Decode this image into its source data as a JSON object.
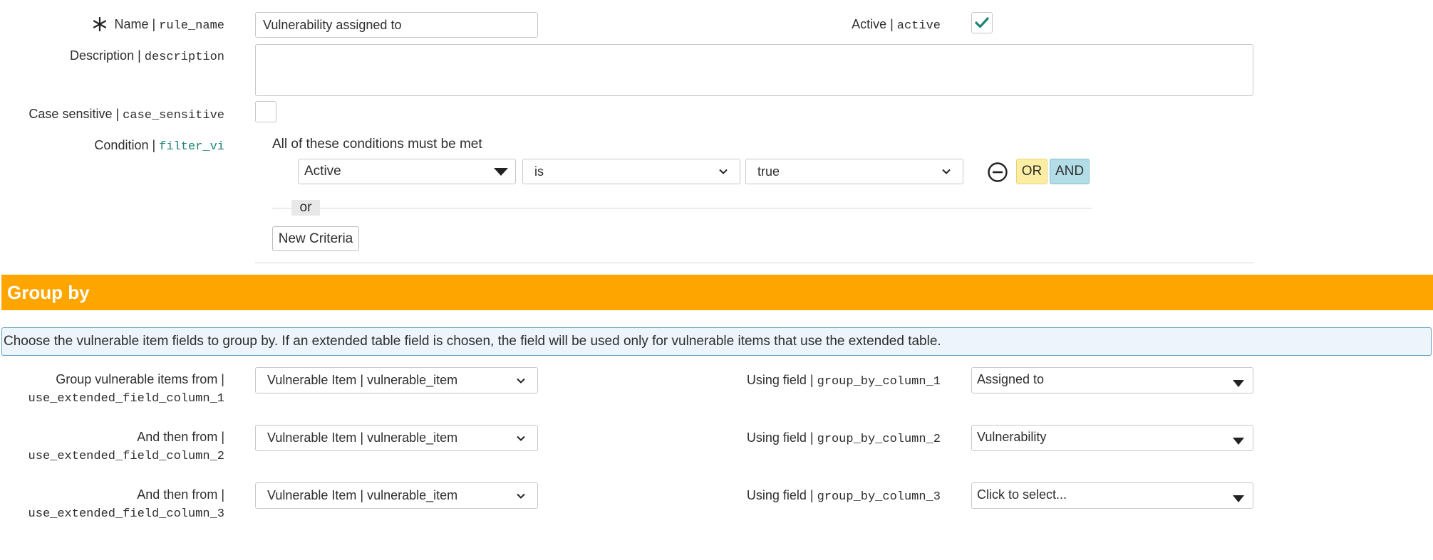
{
  "form": {
    "name": {
      "label": "Name |",
      "field": "rule_name",
      "value": "Vulnerability assigned to"
    },
    "active": {
      "label": "Active |",
      "field": "active",
      "checked": true
    },
    "description": {
      "label": "Description |",
      "field": "description",
      "value": ""
    },
    "case_sensitive": {
      "label": "Case sensitive |",
      "field": "case_sensitive",
      "checked": false
    },
    "condition": {
      "label": "Condition |",
      "field": "filter_vi",
      "heading": "All of these conditions must be met",
      "field_select": "Active",
      "operator_select": "is",
      "value_select": "true",
      "or_button": "OR",
      "and_button": "AND",
      "or_separator": "or",
      "new_criteria_button": "New Criteria"
    }
  },
  "group_by": {
    "title": "Group by",
    "info": "Choose the vulnerable item fields to group by. If an extended table field is chosen, the field will be used only for vulnerable items that use the extended table.",
    "rows": [
      {
        "from_label": "Group vulnerable items from |",
        "from_field": "use_extended_field_column_1",
        "from_value": "Vulnerable Item | vulnerable_item",
        "using_label": "Using field |",
        "using_field": "group_by_column_1",
        "using_value": "Assigned to"
      },
      {
        "from_label": "And then from |",
        "from_field": "use_extended_field_column_2",
        "from_value": "Vulnerable Item | vulnerable_item",
        "using_label": "Using field |",
        "using_field": "group_by_column_2",
        "using_value": "Vulnerability"
      },
      {
        "from_label": "And then from |",
        "from_field": "use_extended_field_column_3",
        "from_value": "Vulnerable Item | vulnerable_item",
        "using_label": "Using field |",
        "using_field": "group_by_column_3",
        "using_value": "Click to select..."
      }
    ]
  },
  "colors": {
    "banner": "#ffa500",
    "check": "#1f8476",
    "or_button": "#fbeea3",
    "and_button": "#b3dde6",
    "teal_field": "#1f8476"
  },
  "icons": {
    "required": "asterisk-icon",
    "checkmark": "checkmark-icon",
    "remove": "minus-circle-icon",
    "dropdown": "chevron-down-icon",
    "caret": "caret-down-icon"
  }
}
